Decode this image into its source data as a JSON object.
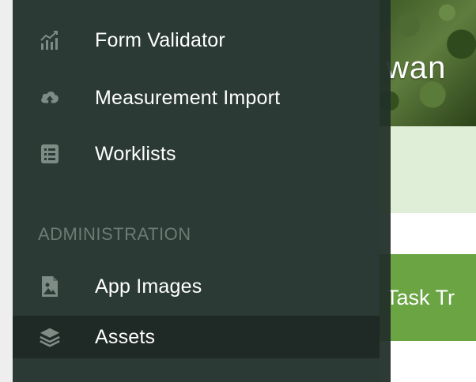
{
  "sidebar": {
    "items": [
      {
        "label": "Form Validator",
        "icon": "chart-bars-icon"
      },
      {
        "label": "Measurement Import",
        "icon": "cloud-upload-icon"
      },
      {
        "label": "Worklists",
        "icon": "list-icon"
      }
    ],
    "sections": [
      {
        "header": "ADMINISTRATION",
        "items": [
          {
            "label": "App Images",
            "icon": "image-file-icon"
          },
          {
            "label": "Assets",
            "icon": "layers-icon",
            "active": true
          }
        ]
      }
    ]
  },
  "background": {
    "header_title": "wan",
    "green_bar_text": "Task Tr"
  },
  "colors": {
    "sidebar_bg": "#2b3a34",
    "sidebar_active_bg": "#1f2925",
    "section_header": "#6d7b74",
    "icon": "#7f8c86",
    "accent_green": "#6aa443"
  }
}
